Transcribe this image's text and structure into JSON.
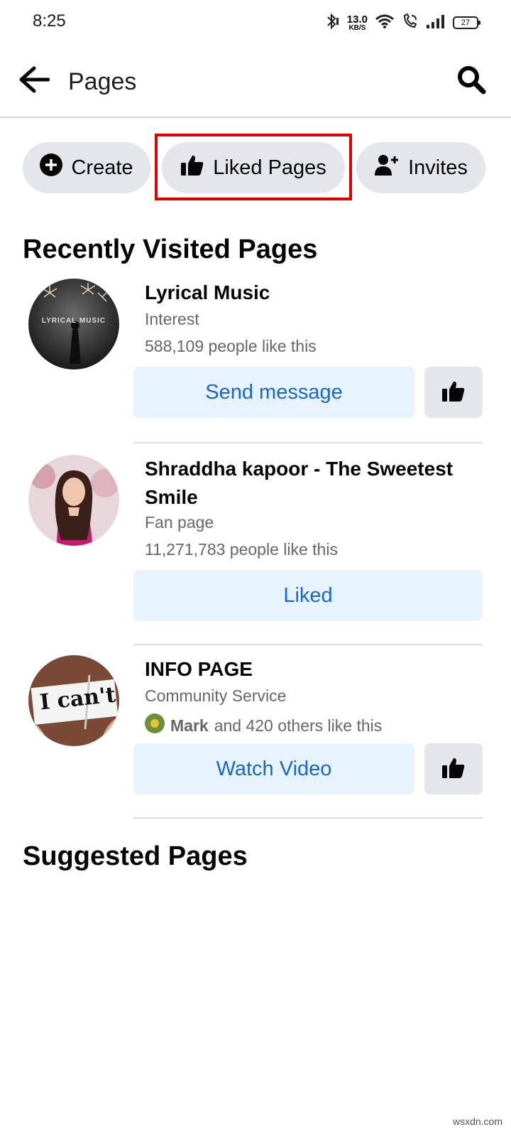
{
  "status_bar": {
    "time": "8:25",
    "net_speed_value": "13.0",
    "net_speed_unit": "KB/S",
    "battery": "27",
    "icons": [
      "bluetooth-icon",
      "wifi-icon",
      "wifi-calling-icon",
      "signal-icon",
      "battery-icon"
    ]
  },
  "header": {
    "title": "Pages",
    "back_icon": "back-arrow-icon",
    "search_icon": "search-icon"
  },
  "chips": [
    {
      "label": "Create",
      "icon": "plus-circle-icon"
    },
    {
      "label": "Liked Pages",
      "icon": "thumbs-up-icon"
    },
    {
      "label": "Invites",
      "icon": "add-person-icon"
    }
  ],
  "highlight_color": "#e00000",
  "recently_visited": {
    "title": "Recently Visited Pages",
    "items": [
      {
        "name": "Lyrical Music",
        "category": "Interest",
        "likes": "588,109 people like this",
        "avatar_text": "LYRICAL MUSIC",
        "action": "Send message",
        "has_like_button": true
      },
      {
        "name": "Shraddha kapoor - The Sweetest Smile",
        "category": "Fan page",
        "likes": "11,271,783 people like this",
        "action": "Liked",
        "has_like_button": false
      },
      {
        "name": "INFO PAGE",
        "category": "Community Service",
        "likes_friend": "Mark",
        "likes_rest": "and 420 others like this",
        "avatar_text": "I can't",
        "action": "Watch Video",
        "has_like_button": true
      }
    ]
  },
  "suggested": {
    "title": "Suggested Pages"
  },
  "watermark": "wsxdn.com",
  "colors": {
    "accent": "#1b66c9",
    "action_bg": "#e7f3ff",
    "chip_bg": "#e4e6eb",
    "secondary_text": "#65676b"
  }
}
